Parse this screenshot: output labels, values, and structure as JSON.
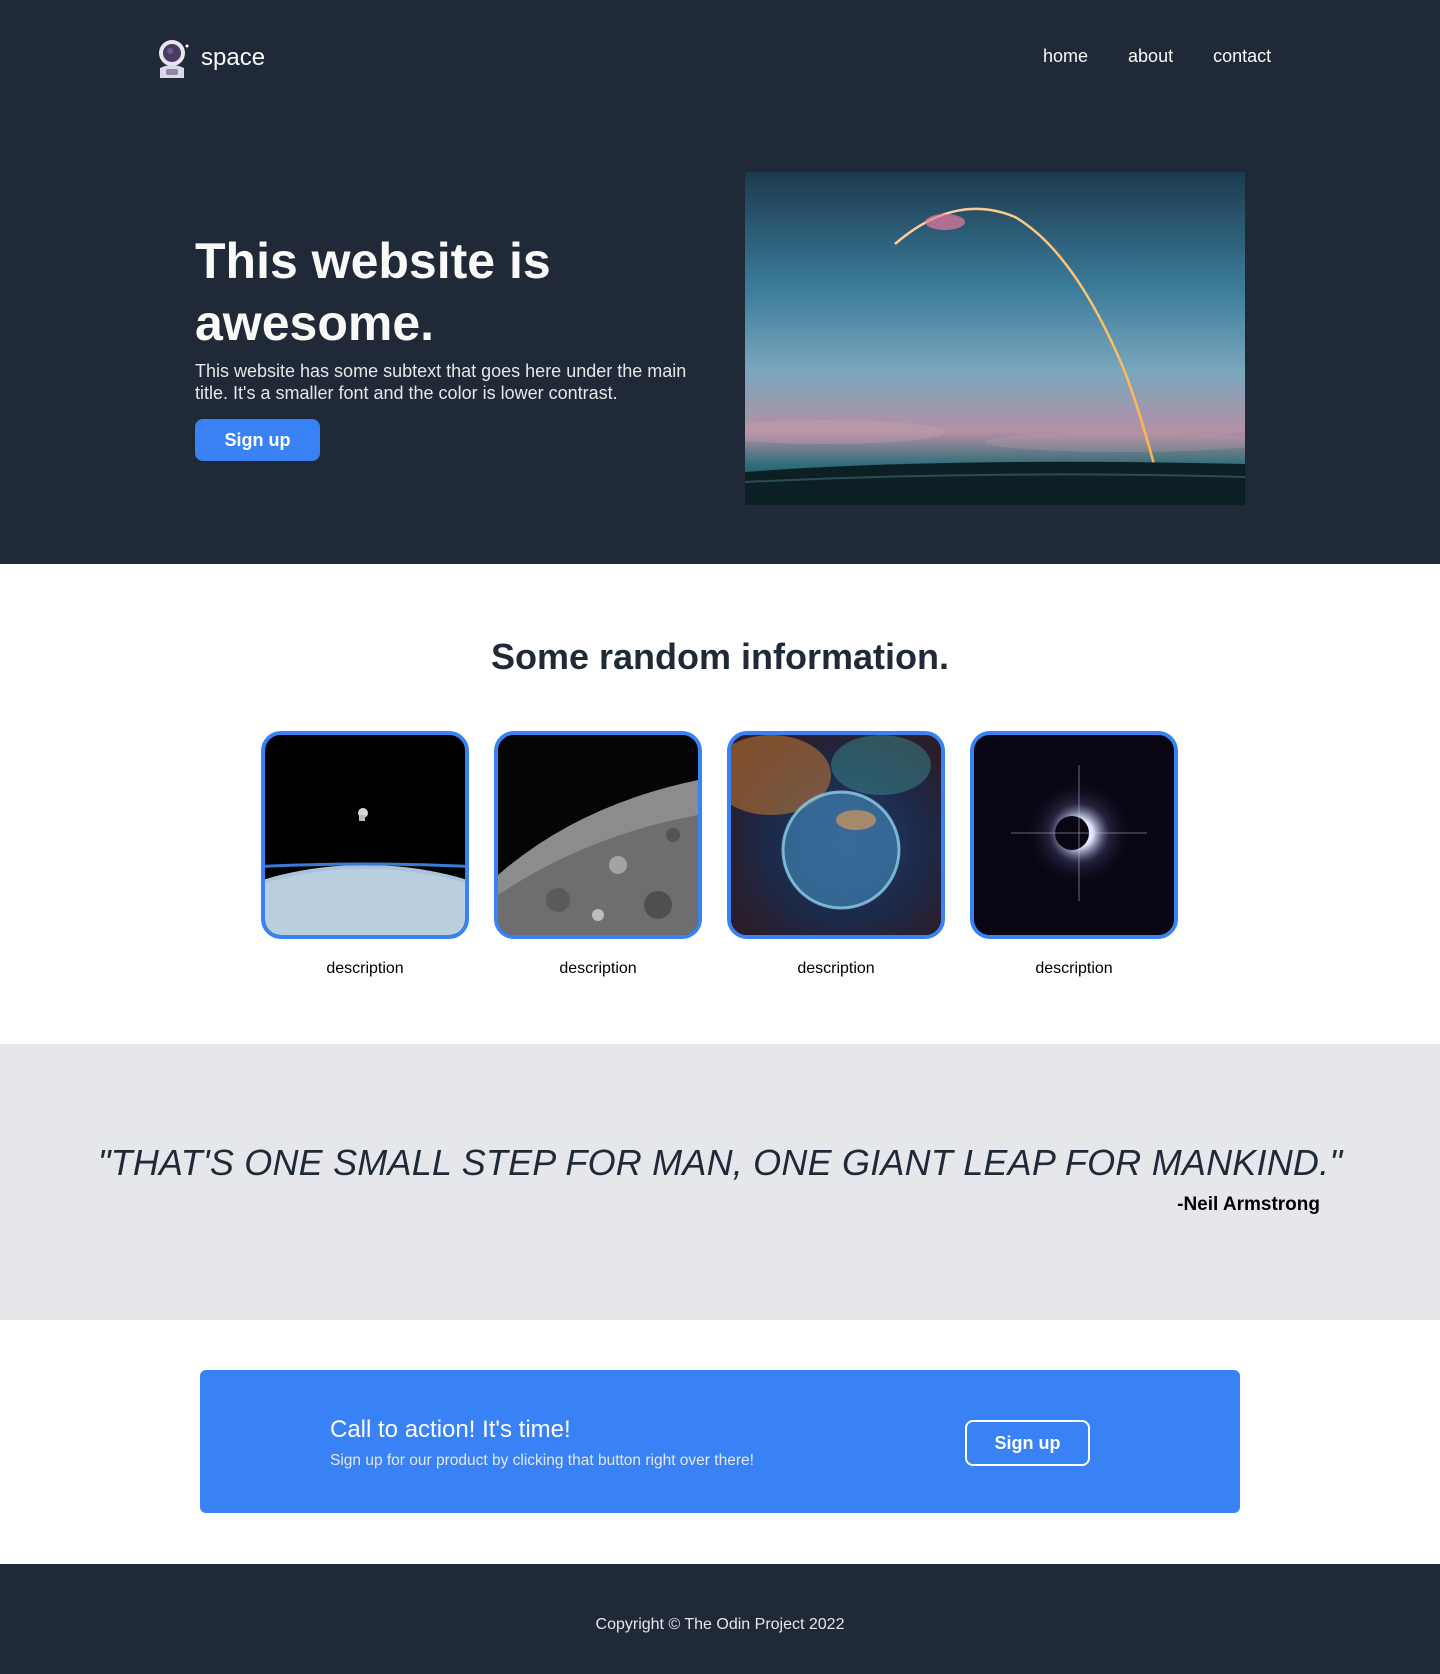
{
  "header": {
    "logo_text": "space",
    "nav": [
      "home",
      "about",
      "contact"
    ]
  },
  "hero": {
    "title": "This website is awesome.",
    "subtitle": "This website has some subtext that goes here under the main title. It's a smaller font and the color is lower contrast.",
    "button_label": "Sign up"
  },
  "info": {
    "title": "Some random information.",
    "cards": [
      {
        "description": "description",
        "image_icon": "astronaut-over-earth-image"
      },
      {
        "description": "description",
        "image_icon": "moon-surface-image"
      },
      {
        "description": "description",
        "image_icon": "nebula-bubble-image"
      },
      {
        "description": "description",
        "image_icon": "solar-eclipse-image"
      }
    ]
  },
  "quote": {
    "text": "\"THAT'S ONE SMALL STEP FOR MAN, ONE GIANT LEAP FOR MANKIND.\"",
    "author": "-Neil Armstrong"
  },
  "cta": {
    "title": "Call to action! It's time!",
    "subtitle": "Sign up for our product by clicking that button right over there!",
    "button_label": "Sign up"
  },
  "footer": {
    "copyright": "Copyright © The Odin Project 2022"
  },
  "colors": {
    "dark": "#1f2937",
    "accent": "#3882f6",
    "light_gray": "#e5e7eb",
    "off_white": "#f9faf8"
  }
}
